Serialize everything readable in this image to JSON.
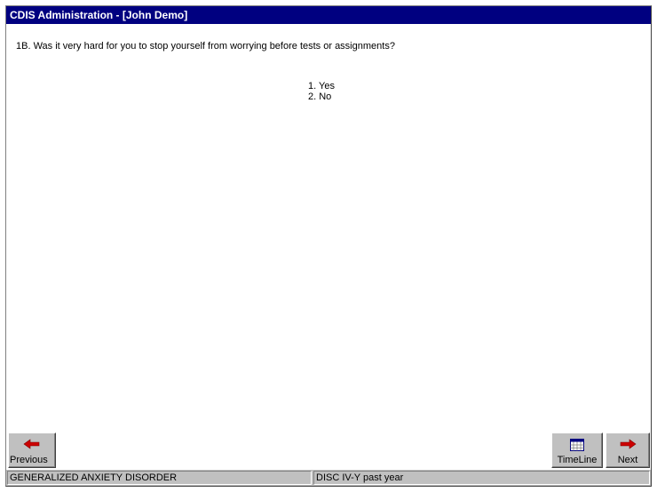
{
  "window": {
    "title": "CDIS Administration - [John Demo]"
  },
  "question": {
    "text": "1B. Was it very hard for you to stop yourself from worrying before tests or assignments?",
    "options": [
      "1. Yes",
      "2. No"
    ]
  },
  "buttons": {
    "previous": {
      "label": "Previous",
      "icon": "arrow-left-icon"
    },
    "timeline": {
      "label": "TimeLine",
      "icon": "calendar-icon"
    },
    "next": {
      "label": "Next",
      "icon": "arrow-right-icon"
    }
  },
  "status": {
    "section": "GENERALIZED ANXIETY DISORDER",
    "module": "DISC IV-Y past year"
  },
  "colors": {
    "titlebar": "#000080",
    "button_face": "#c0c0c0",
    "arrow": "#cc0000"
  }
}
